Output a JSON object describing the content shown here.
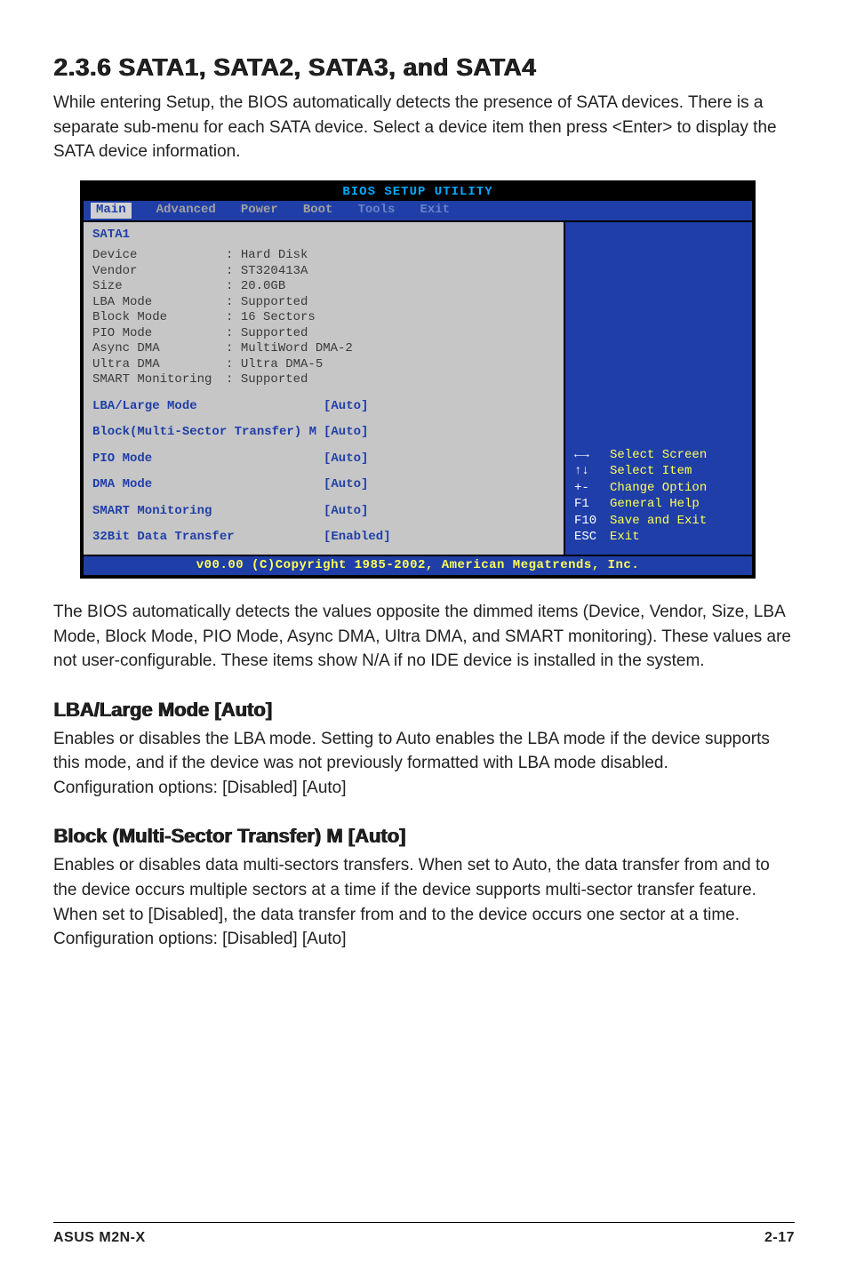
{
  "heading_main": "2.3.6   SATA1, SATA2, SATA3, and SATA4",
  "intro_text": "While entering Setup, the BIOS automatically detects the presence of SATA devices. There is a separate sub-menu for each SATA device. Select a device item then press <Enter> to display the SATA device information.",
  "bios": {
    "title": "BIOS SETUP UTILITY",
    "tabs": {
      "main": "Main",
      "advanced": "Advanced",
      "power": "Power",
      "boot": "Boot",
      "tools": "Tools",
      "exit": "Exit"
    },
    "panel_title": "SATA1",
    "info": {
      "device_k": "Device",
      "device_v": "Hard Disk",
      "vendor_k": "Vendor",
      "vendor_v": "ST320413A",
      "size_k": "Size",
      "size_v": "20.0GB",
      "lba_k": "LBA Mode",
      "lba_v": "Supported",
      "block_k": "Block Mode",
      "block_v": "16 Sectors",
      "pio_k": "PIO Mode",
      "pio_v": "Supported",
      "async_k": "Async DMA",
      "async_v": "MultiWord DMA-2",
      "ultra_k": "Ultra DMA",
      "ultra_v": "Ultra DMA-5",
      "smart_k": "SMART Monitoring",
      "smart_v": "Supported"
    },
    "settings": {
      "lba_large_k": "LBA/Large Mode",
      "lba_large_v": "[Auto]",
      "block_multi_k": "Block(Multi-Sector Transfer) M",
      "block_multi_v": "[Auto]",
      "pio_mode_k": "PIO Mode",
      "pio_mode_v": "[Auto]",
      "dma_mode_k": "DMA Mode",
      "dma_mode_v": "[Auto]",
      "smart_mon_k": "SMART Monitoring",
      "smart_mon_v": "[Auto]",
      "bit32_k": "32Bit Data Transfer",
      "bit32_v": "[Enabled]"
    },
    "hints": {
      "lr_k": "←→",
      "lr_v": "Select Screen",
      "ud_k": "↑↓",
      "ud_v": "Select Item",
      "pm_k": "+-",
      "pm_v": "Change Option",
      "f1_k": "F1",
      "f1_v": "General Help",
      "f10_k": "F10",
      "f10_v": "Save and Exit",
      "esc_k": "ESC",
      "esc_v": "Exit"
    },
    "footer": "v00.00 (C)Copyright 1985-2002, American Megatrends, Inc."
  },
  "post_bios_text": "The BIOS automatically detects the values opposite the dimmed items (Device, Vendor, Size, LBA Mode, Block Mode, PIO Mode, Async DMA, Ultra DMA, and SMART monitoring). These values are not user-configurable. These items show N/A if no IDE device is installed in the system.",
  "lba_heading": "LBA/Large Mode [Auto]",
  "lba_text": "Enables or disables the LBA mode. Setting to Auto enables the LBA mode if the device supports this mode, and if the device was not previously formatted with LBA mode disabled.\nConfiguration options: [Disabled] [Auto]",
  "block_heading": "Block (Multi-Sector Transfer) M [Auto]",
  "block_text": "Enables or disables data multi-sectors transfers. When set to Auto, the data transfer from and to the device occurs multiple sectors at a time if the device supports multi-sector transfer feature. When set to [Disabled], the data transfer from and to the device occurs one sector at a time. Configuration options: [Disabled] [Auto]",
  "footer_left": "ASUS M2N-X",
  "footer_right": "2-17"
}
